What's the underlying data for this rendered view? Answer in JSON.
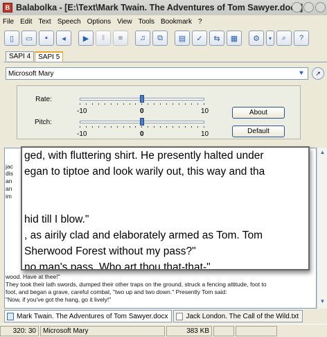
{
  "window": {
    "title": "Balabolka - [E:\\Text\\Mark Twain. The Adventures of Tom Sawyer.docx]"
  },
  "menu": [
    "File",
    "Edit",
    "Text",
    "Speech",
    "Options",
    "View",
    "Tools",
    "Bookmark",
    "?"
  ],
  "toolbar": [
    {
      "icon": "new-document-icon",
      "glyph": "▯",
      "enabled": true
    },
    {
      "icon": "open-folder-icon",
      "glyph": "▭",
      "enabled": true
    },
    {
      "icon": "save-disk-icon",
      "glyph": "▪",
      "enabled": true
    },
    {
      "icon": "speaker-icon",
      "glyph": "◂",
      "enabled": true
    },
    {
      "icon": "play-icon",
      "glyph": "▶",
      "enabled": true
    },
    {
      "icon": "pause-icon",
      "glyph": "‖",
      "enabled": false
    },
    {
      "icon": "stop-icon",
      "glyph": "■",
      "enabled": false
    },
    {
      "icon": "save-audio-icon",
      "glyph": "♫",
      "enabled": true
    },
    {
      "icon": "split-files-icon",
      "glyph": "⧉",
      "enabled": true
    },
    {
      "icon": "magnifier-text-icon",
      "glyph": "▤",
      "enabled": true
    },
    {
      "icon": "spell-check-icon",
      "glyph": "✓",
      "enabled": true
    },
    {
      "icon": "convert-icon",
      "glyph": "⇆",
      "enabled": true
    },
    {
      "icon": "clipboard-icon",
      "glyph": "▦",
      "enabled": true
    },
    {
      "icon": "settings-icon",
      "glyph": "⚙",
      "enabled": true
    },
    {
      "icon": "dropdown-arrow-icon",
      "glyph": "▾",
      "enabled": true
    },
    {
      "icon": "search-icon",
      "glyph": "⌕",
      "enabled": true
    },
    {
      "icon": "help-icon",
      "glyph": "?",
      "enabled": true
    }
  ],
  "engine_tabs": [
    {
      "label": "SAPI 4",
      "active": false
    },
    {
      "label": "SAPI 5",
      "active": true
    }
  ],
  "voice": {
    "selected": "Microsoft Mary"
  },
  "sliders": {
    "rate": {
      "label": "Rate:",
      "min": "-10",
      "mid": "0",
      "max": "10",
      "value": 0
    },
    "pitch": {
      "label": "Pitch:",
      "min": "-10",
      "mid": "0",
      "max": "10",
      "value": 0
    }
  },
  "buttons": {
    "about": "About",
    "default": "Default"
  },
  "text_behind": {
    "top": [
      "jac",
      "dis",
      "an",
      "an",
      "im"
    ],
    "bottom": [
      "wood. Have at thee!\"",
      "   They took their lath swords, dumped their other traps on the ground, struck a fencing attitude, foot to",
      "foot, and began a grave, careful combat, \"two up and two down.\" Presently Tom said:",
      "   \"Now, if you've got the hang, go it lively!\""
    ]
  },
  "magnifier_lines": [
    "ged, with fluttering shirt. He presently halted under",
    "egan to tiptoe and look warily out, this way and tha",
    "",
    "",
    " hid till I blow.\"",
    ", as airily clad and elaborately armed as Tom. Tom",
    " Sherwood Forest without my pass?\"",
    "no man's pass. Who art thou that-that-\""
  ],
  "document_tabs": [
    {
      "label": "Mark Twain. The Adventures of Tom Sawyer.docx",
      "active": true
    },
    {
      "label": "Jack London. The Call of the Wild.txt",
      "active": false
    }
  ],
  "status": {
    "position": "320:  30",
    "voice": "Microsoft Mary",
    "size": "383 KB"
  },
  "colors": {
    "active_tab_accent": "#e7a534",
    "slider_thumb": "#4d7cc7"
  }
}
